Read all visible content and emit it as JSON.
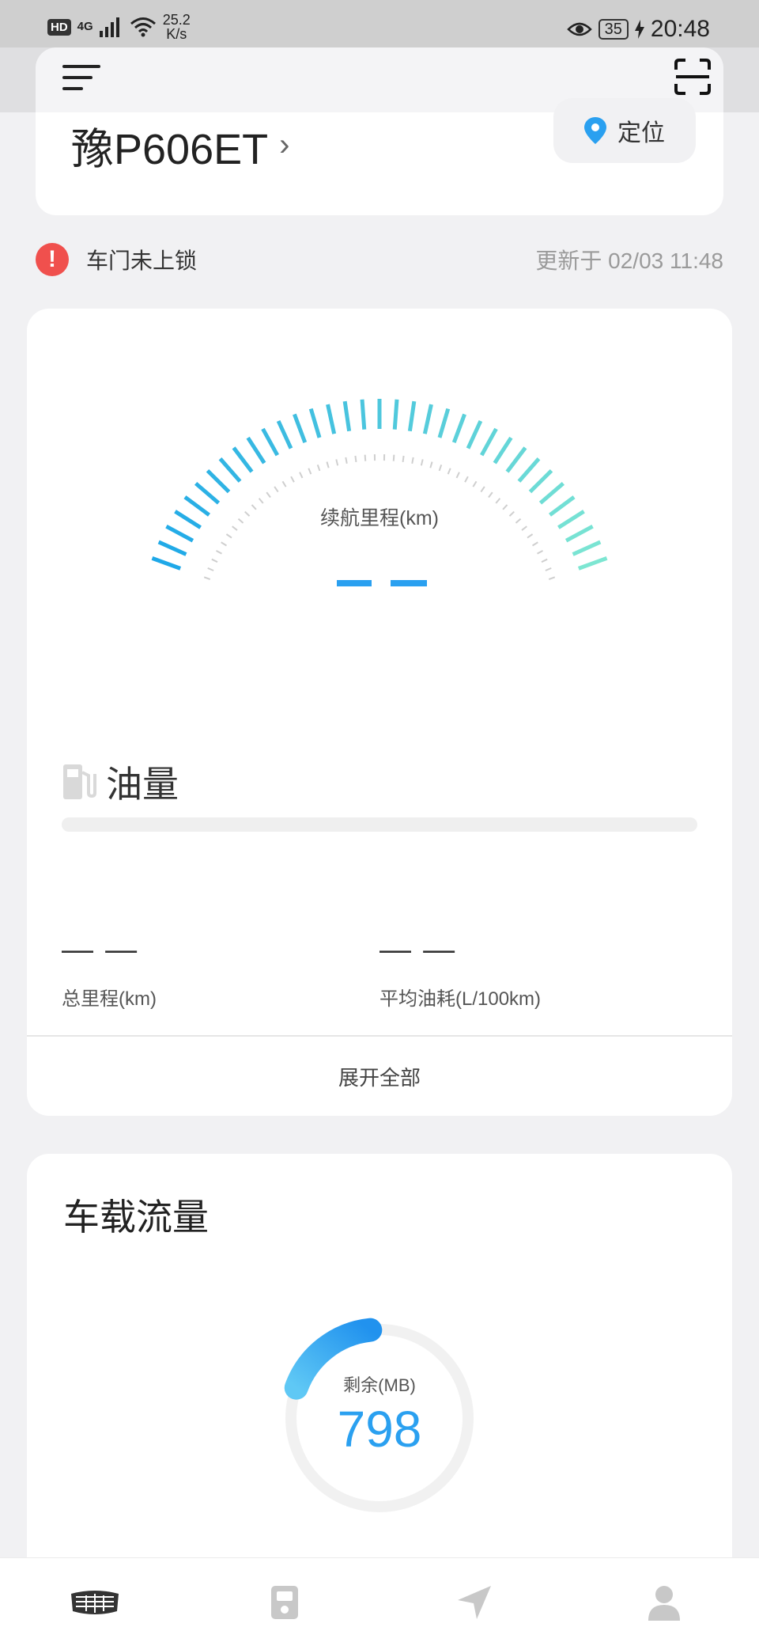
{
  "status_bar": {
    "hd": "HD",
    "network": "4G",
    "speed_value": "25.2",
    "speed_unit": "K/s",
    "battery": "35",
    "time": "20:48"
  },
  "header": {
    "menu_icon": "menu-icon",
    "scan_icon": "scan-icon"
  },
  "vehicle": {
    "plate": "豫P606ET",
    "locate_label": "定位"
  },
  "alert": {
    "icon": "!",
    "text": "车门未上锁",
    "updated": "更新于 02/03 11:48"
  },
  "range": {
    "label": "续航里程(km)",
    "value": "— —"
  },
  "fuel": {
    "label": "油量",
    "level": 0
  },
  "stats": {
    "total_mileage_value": "— —",
    "total_mileage_label": "总里程(km)",
    "avg_consumption_value": "— —",
    "avg_consumption_label": "平均油耗(L/100km)"
  },
  "expand_label": "展开全部",
  "data_card": {
    "title": "车载流量",
    "remaining_label": "剩余(MB)",
    "remaining_value": "798"
  },
  "colors": {
    "accent_blue": "#2aa0f0",
    "gauge_start": "#1ea8e8",
    "gauge_end": "#7de6d2",
    "alert_red": "#f0504d"
  },
  "tabs": [
    {
      "icon": "car-logo-icon"
    },
    {
      "icon": "vehicle-control-icon"
    },
    {
      "icon": "navigation-icon"
    },
    {
      "icon": "profile-icon"
    }
  ]
}
